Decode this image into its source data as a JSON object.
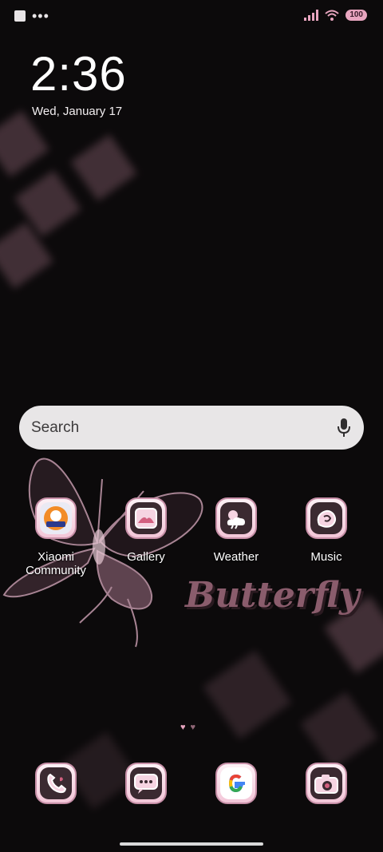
{
  "status_bar": {
    "battery": "100",
    "left_icons": [
      "notification-square-icon",
      "more-dots-icon"
    ],
    "right_icons": [
      "signal-icon",
      "wifi-icon",
      "battery-icon"
    ]
  },
  "lock": {
    "time": "2:36",
    "date": "Wed, January 17"
  },
  "search": {
    "placeholder": "Search",
    "icon": "mic-icon"
  },
  "apps": [
    {
      "label": "Xiaomi\nCommunity",
      "icon": "xiaomi-community-icon"
    },
    {
      "label": "Gallery",
      "icon": "gallery-icon"
    },
    {
      "label": "Weather",
      "icon": "weather-icon"
    },
    {
      "label": "Music",
      "icon": "music-icon"
    }
  ],
  "wallpaper_text": "Butterfly",
  "dock": [
    {
      "icon": "phone-icon"
    },
    {
      "icon": "messages-icon"
    },
    {
      "icon": "google-icon"
    },
    {
      "icon": "camera-icon"
    }
  ],
  "colors": {
    "accent": "#e8a5bf",
    "icon_frame": "#c890a8",
    "background": "#0c0a0b"
  }
}
